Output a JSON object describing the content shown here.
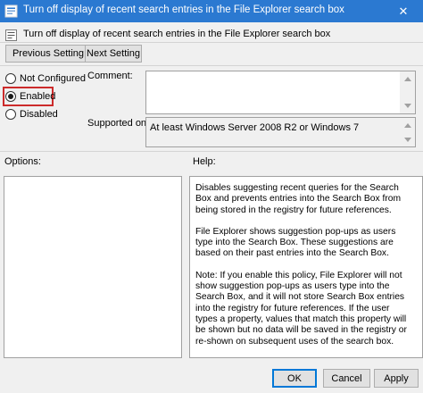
{
  "window": {
    "title": "Turn off display of recent search entries in the File Explorer search box",
    "close_glyph": "✕"
  },
  "header": {
    "title": "Turn off display of recent search entries in the File Explorer search box"
  },
  "nav": {
    "previous_label": "Previous Setting",
    "next_label": "Next Setting"
  },
  "state": {
    "options": [
      {
        "label": "Not Configured",
        "checked": false
      },
      {
        "label": "Enabled",
        "checked": true
      },
      {
        "label": "Disabled",
        "checked": false
      }
    ]
  },
  "comment": {
    "label": "Comment:",
    "value": ""
  },
  "supported": {
    "label": "Supported on:",
    "value": "At least Windows Server 2008 R2 or Windows 7"
  },
  "options_panel": {
    "label": "Options:"
  },
  "help_panel": {
    "label": "Help:",
    "paragraphs": [
      "Disables suggesting recent queries for the Search Box and prevents entries into the Search Box from being stored in the registry for future references.",
      "File Explorer shows suggestion pop-ups as users type into the Search Box.  These suggestions are based on their past entries into the Search Box.",
      "Note: If you enable this policy, File Explorer will not show suggestion pop-ups as users type into the Search Box, and it will not store Search Box entries into the registry for future references.  If the user types a property, values that match this property will be shown but no data will be saved in the registry or re-shown on subsequent uses of the search box."
    ]
  },
  "footer": {
    "ok_label": "OK",
    "cancel_label": "Cancel",
    "apply_label": "Apply"
  },
  "colors": {
    "titlebar": "#2b79d1",
    "highlight": "#cc2b2b",
    "focus": "#0078d7"
  }
}
